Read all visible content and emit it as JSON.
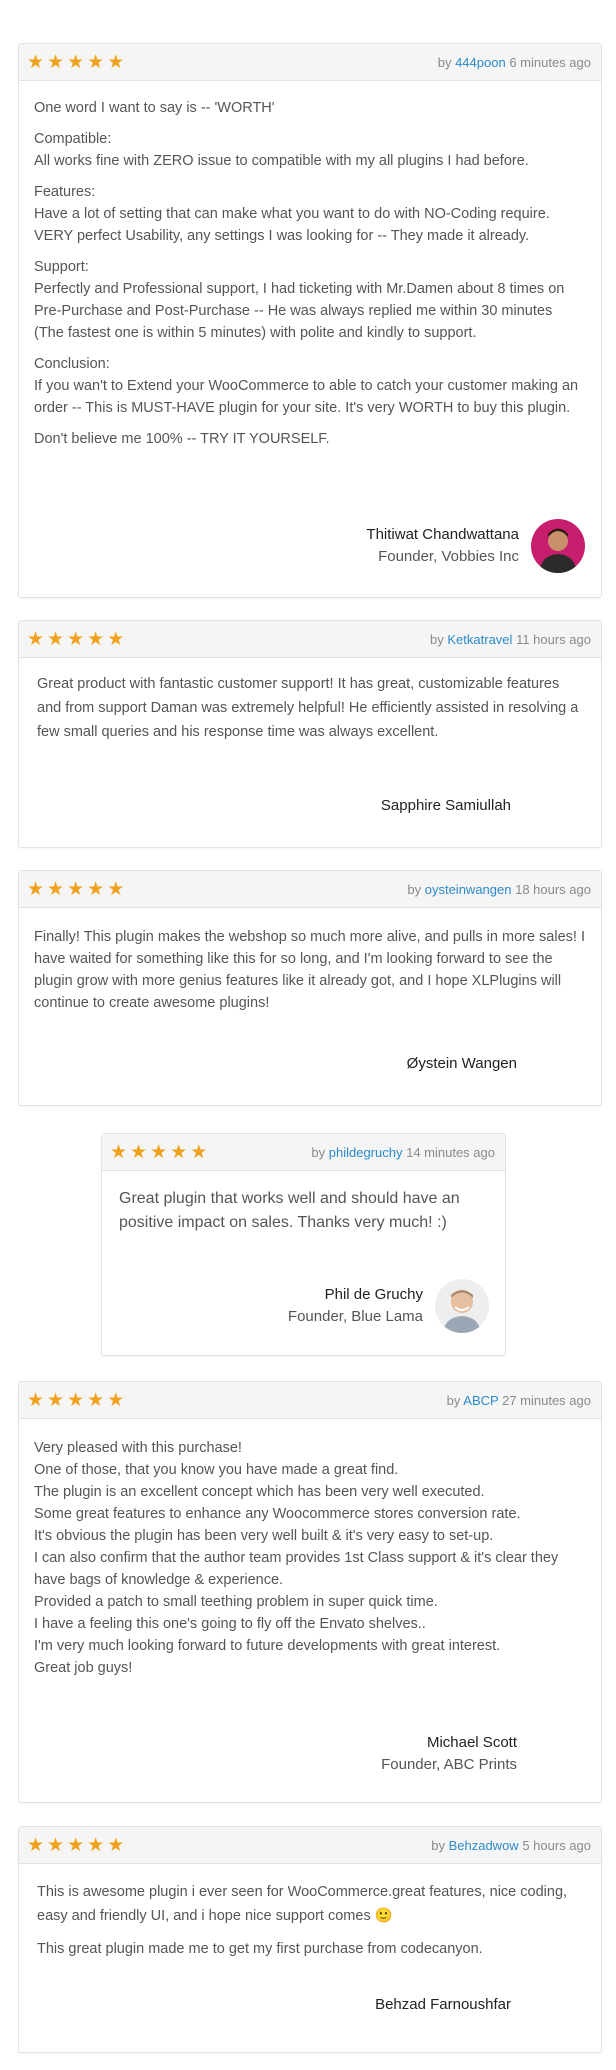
{
  "colors": {
    "star": "#f0a21e",
    "author_link": "#2b8acb",
    "header_bg": "#f5f5f5",
    "border": "#e2e2e2"
  },
  "reviews": [
    {
      "by": "by",
      "author": "444poon",
      "time": "6 minutes ago",
      "paragraphs": [
        "One word I want to say is -- 'WORTH'",
        "Compatible:\nAll works fine with ZERO issue to compatible with my all plugins I had before.",
        "Features:\nHave a lot of setting that can make what you want to do with NO-Coding require. VERY perfect Usability, any settings I was looking for -- They made it already.",
        "Support:\nPerfectly and Professional support, I had ticketing with Mr.Damen about 8 times on Pre-Purchase and Post-Purchase -- He was always replied me within 30 minutes (The fastest one is within 5 minutes) with polite and kindly to support.",
        "Conclusion:\nIf you wan't to Extend your WooCommerce to able to catch your customer making an order -- This is MUST-HAVE plugin for your site. It's very WORTH to buy this plugin.",
        "Don't believe me 100% -- TRY IT YOURSELF."
      ],
      "sig_name": "Thitiwat Chandwattana",
      "sig_title": "Founder, Vobbies Inc"
    },
    {
      "by": "by",
      "author": "Ketkatravel",
      "time": "11 hours ago",
      "paragraphs": [
        "Great product with fantastic customer support! It has great, customizable features and from support Daman was extremely helpful! He efficiently assisted in resolving a few small queries and his response time was always excellent."
      ],
      "sig_name": "Sapphire Samiullah"
    },
    {
      "by": "by",
      "author": "oysteinwangen",
      "time": "18 hours ago",
      "paragraphs": [
        "Finally! This plugin makes the webshop so much more alive, and pulls in more sales! I have waited for something like this for so long, and I'm looking forward to see the plugin grow with more genius features like it already got, and I hope XLPlugins will continue to create awesome plugins!"
      ],
      "sig_name": "Øystein Wangen"
    },
    {
      "by": "by",
      "author": "phildegruchy",
      "time": "14 minutes ago",
      "paragraphs": [
        "Great plugin that works well and should have an positive impact on sales. Thanks very much! :)"
      ],
      "sig_name": "Phil de Gruchy",
      "sig_title": "Founder, Blue Lama"
    },
    {
      "by": "by",
      "author": "ABCP",
      "time": "27 minutes ago",
      "paragraphs": [
        "Very pleased with this purchase!\nOne of those, that you know you have made a great find.\nThe plugin is an excellent concept which has been very well executed.\nSome great features to enhance any Woocommerce stores conversion rate.\nIt's obvious the plugin has been very well built & it's very easy to set-up.\nI can also confirm that the author team provides 1st Class support & it's clear they have bags of knowledge & experience.\nProvided a patch to small teething problem in super quick time.\nI have a feeling this one's going to fly off the Envato shelves..\nI'm very much looking forward to future developments with great interest.\nGreat job guys!"
      ],
      "sig_name": "Michael Scott",
      "sig_title": "Founder, ABC Prints"
    },
    {
      "by": "by",
      "author": "Behzadwow",
      "time": "5 hours ago",
      "paragraphs": [
        "This is awesome plugin i ever seen for WooCommerce.great features, nice coding, easy and friendly UI, and i hope nice support comes 🙂",
        "This great plugin made me to get my first purchase from codecanyon."
      ],
      "sig_name": "Behzad Farnoushfar"
    }
  ]
}
